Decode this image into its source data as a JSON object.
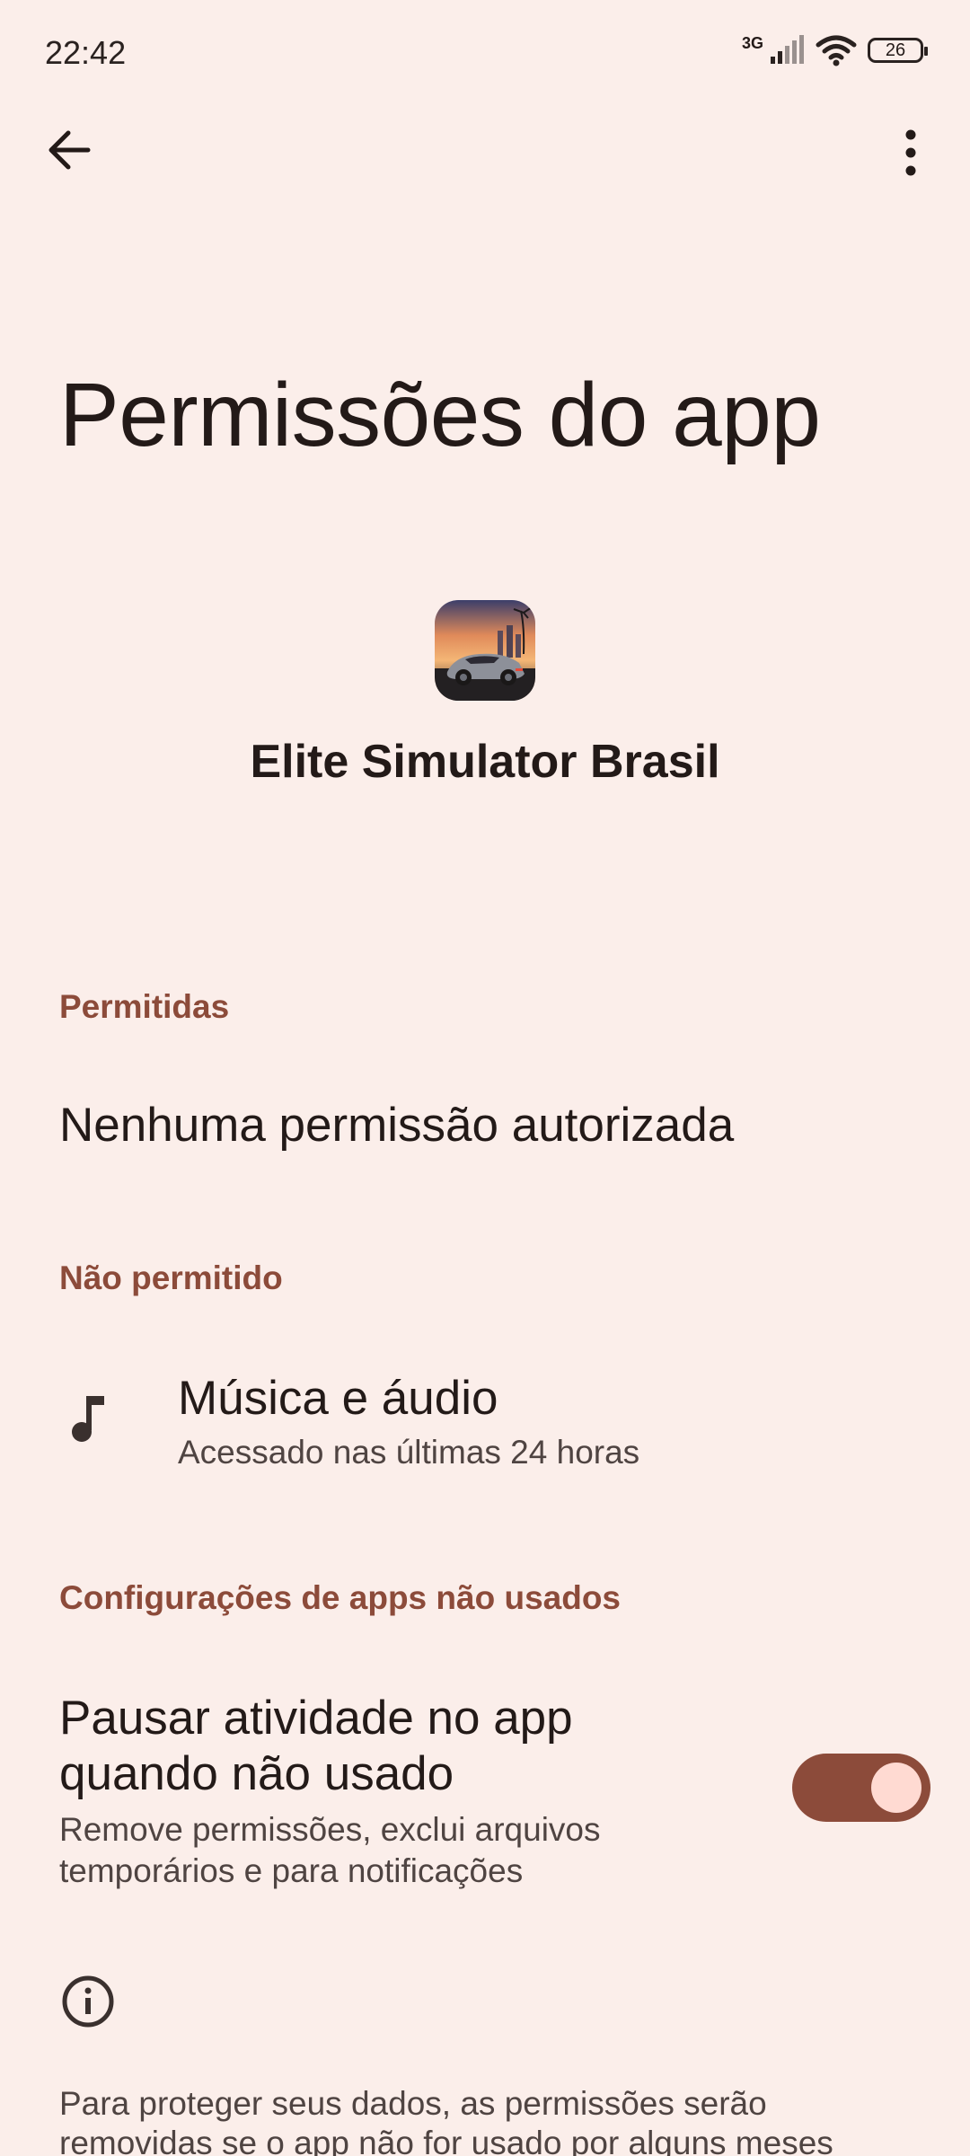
{
  "status_bar": {
    "time": "22:42",
    "network": "3G",
    "battery": "26",
    "icons": [
      "signal-icon",
      "wifi-icon",
      "battery-icon"
    ]
  },
  "app_bar": {
    "back_icon": "arrow-left-icon",
    "more_icon": "more-vert-icon"
  },
  "page": {
    "title": "Permissões do app",
    "app_name": "Elite Simulator Brasil"
  },
  "sections": {
    "allowed": {
      "header": "Permitidas",
      "empty_text": "Nenhuma permissão autorizada"
    },
    "denied": {
      "header": "Não permitido",
      "items": [
        {
          "icon": "music-note-icon",
          "title": "Música e áudio",
          "subtitle": "Acessado nas últimas 24 horas"
        }
      ]
    },
    "unused_apps": {
      "header": "Configurações de apps não usados",
      "pause_title_line1": "Pausar atividade no app",
      "pause_title_line2": "quando não usado",
      "pause_subtitle_line1": "Remove permissões, exclui arquivos",
      "pause_subtitle_line2": "temporários e para notificações",
      "pause_enabled": true
    }
  },
  "info": {
    "icon": "info-icon",
    "text_line1": "Para proteger seus dados, as permissões serão",
    "text_line2": "removidas se o app não for usado por alguns meses"
  },
  "colors": {
    "background": "#fbeeea",
    "accent": "#8c4b3a",
    "toggle_knob": "#ffdad2"
  }
}
